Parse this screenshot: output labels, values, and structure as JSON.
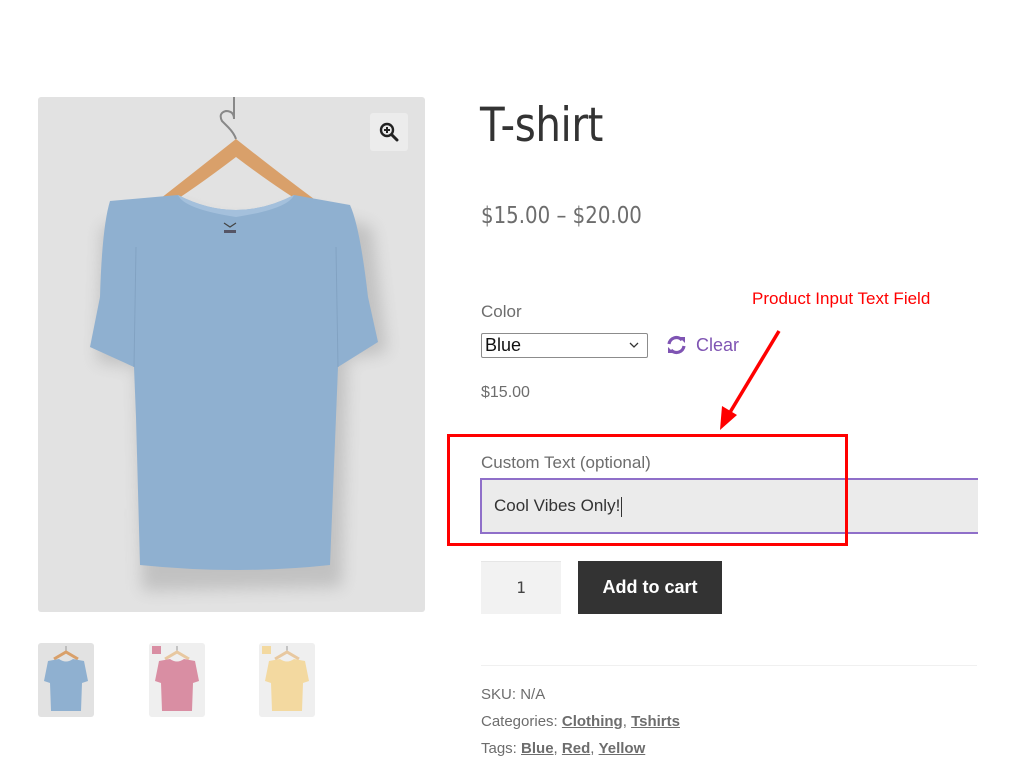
{
  "product": {
    "title": "T-shirt",
    "price_range": "$15.00 – $20.00",
    "variation_price": "$15.00"
  },
  "gallery": {
    "main_image_alt": "Blue T-shirt on hanger",
    "zoom_icon": "magnify-plus-icon",
    "thumbnails": [
      {
        "alt": "Blue T-shirt",
        "color": "#8fb0d0",
        "active": true
      },
      {
        "alt": "Red T-shirt",
        "color": "#d98ea3",
        "active": false
      },
      {
        "alt": "Yellow T-shirt",
        "color": "#f3d9a0",
        "active": false
      }
    ]
  },
  "variations": {
    "color_label": "Color",
    "color_selected": "Blue",
    "clear_label": "Clear",
    "clear_icon": "refresh-icon"
  },
  "custom_text": {
    "label": "Custom Text (optional)",
    "value": "Cool Vibes Only!"
  },
  "cart": {
    "quantity": "1",
    "add_to_cart_label": "Add to cart"
  },
  "meta": {
    "sku_label": "SKU:",
    "sku_value": "N/A",
    "categories_label": "Categories:",
    "categories": [
      "Clothing",
      "Tshirts"
    ],
    "tags_label": "Tags:",
    "tags": [
      "Blue",
      "Red",
      "Yellow"
    ]
  },
  "annotation": {
    "label": "Product Input Text Field",
    "color": "#ff0000"
  },
  "colors": {
    "accent": "#7f54b3",
    "button_bg": "#333333",
    "input_border": "#8f6fc9"
  }
}
